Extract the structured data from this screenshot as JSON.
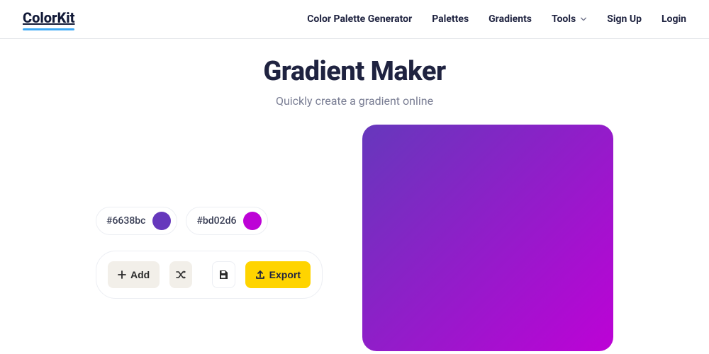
{
  "brand": {
    "name": "ColorKit"
  },
  "nav": {
    "items": [
      {
        "label": "Color Palette Generator"
      },
      {
        "label": "Palettes"
      },
      {
        "label": "Gradients"
      },
      {
        "label": "Tools",
        "dropdown": true
      },
      {
        "label": "Sign Up"
      },
      {
        "label": "Login"
      }
    ]
  },
  "page": {
    "title": "Gradient Maker",
    "subtitle": "Quickly create a gradient online"
  },
  "gradient": {
    "stops": [
      {
        "hex": "#6638bc"
      },
      {
        "hex": "#bd02d6"
      }
    ],
    "angle_deg": 135
  },
  "toolbar": {
    "add_label": "Add",
    "export_label": "Export"
  }
}
